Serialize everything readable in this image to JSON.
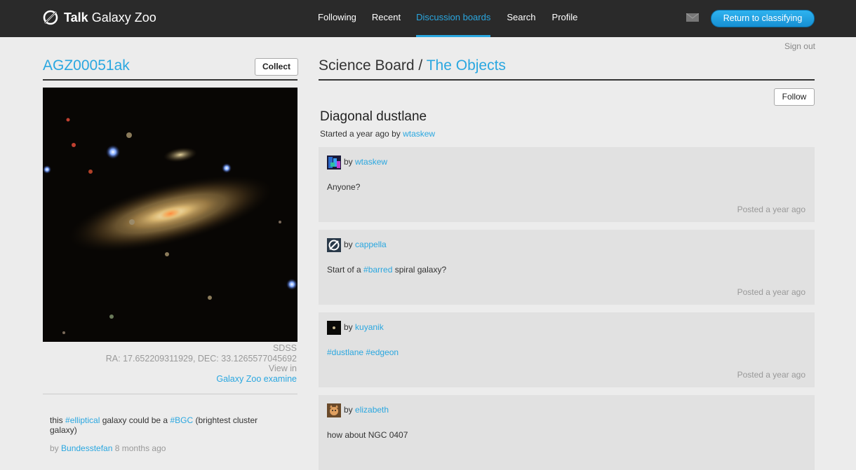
{
  "header": {
    "logo": {
      "bold": "Talk",
      "rest": " Galaxy Zoo"
    },
    "nav": [
      {
        "label": "Following",
        "active": false
      },
      {
        "label": "Recent",
        "active": false
      },
      {
        "label": "Discussion boards",
        "active": true
      },
      {
        "label": "Search",
        "active": false
      },
      {
        "label": "Profile",
        "active": false
      }
    ],
    "return_label": "Return to classifying",
    "sign_out": "Sign out"
  },
  "subject": {
    "id": "AGZ00051ak",
    "collect_label": "Collect",
    "source": "SDSS",
    "coords": "RA: 17.652209311929, DEC: 33.1265577045692",
    "view_in": "View in",
    "examine_link": "Galaxy Zoo examine"
  },
  "comment": {
    "pre": "this ",
    "tag1": "#elliptical",
    "mid": " galaxy could be a ",
    "tag2": "#BGC",
    "post": " (brightest cluster galaxy)",
    "by": "by ",
    "author": "Bundesstefan",
    "time": " 8 months ago"
  },
  "board": {
    "name": "Science Board",
    "sep": " / ",
    "section": "The Objects",
    "follow_label": "Follow"
  },
  "discussion": {
    "title": "Diagonal dustlane",
    "started": "Started a year ago by ",
    "starter": "wtaskew"
  },
  "posts": [
    {
      "by": "by ",
      "user": "wtaskew",
      "posted": "Posted a year ago",
      "body": {
        "pre": "Anyone?",
        "tag": "",
        "post": ""
      }
    },
    {
      "by": "by ",
      "user": "cappella",
      "posted": "Posted a year ago",
      "body": {
        "pre": "Start of a ",
        "tag": "#barred",
        "post": " spiral galaxy?"
      }
    },
    {
      "by": "by ",
      "user": "kuyanik",
      "posted": "Posted a year ago",
      "body": {
        "pre": "",
        "tag": "#dustlane #edgeon",
        "post": ""
      }
    },
    {
      "by": "by ",
      "user": "elizabeth",
      "posted": "",
      "body": {
        "pre": "how about NGC 0407",
        "tag": "",
        "post": ""
      }
    }
  ],
  "icons": {
    "logo": "galaxy-zoo-logo-icon",
    "mail": "mail-icon"
  },
  "colors": {
    "accent": "#2aa7e0",
    "topbar": "#2a2a2a",
    "background": "#ececec",
    "post_bg": "#e1e1e1"
  }
}
